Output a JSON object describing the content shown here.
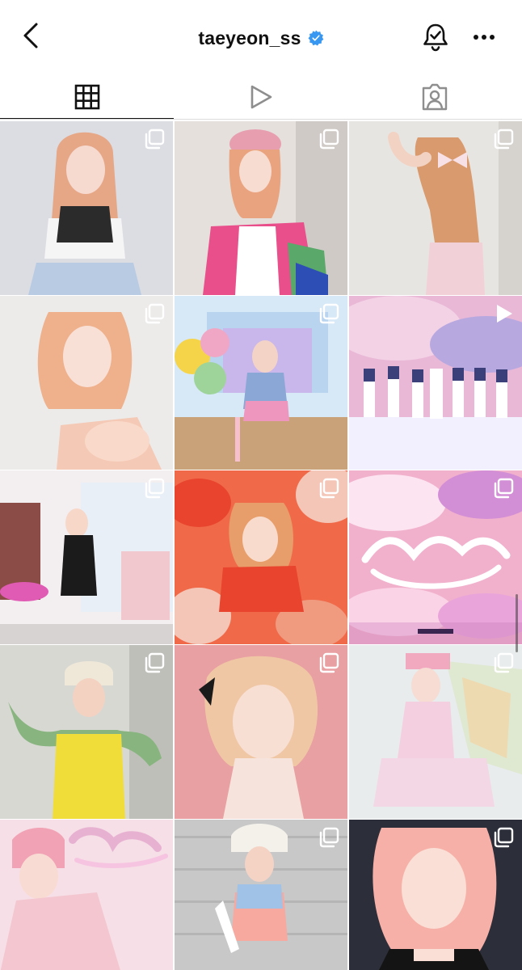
{
  "header": {
    "username": "taeyeon_ss",
    "verified": true,
    "back_icon": "chevron-left-icon",
    "bell_icon": "bell-check-icon",
    "more_icon": "more-horizontal-icon",
    "accent_color": "#3897f0"
  },
  "tabs": [
    {
      "name": "grid",
      "icon": "grid-icon",
      "active": true
    },
    {
      "name": "reels",
      "icon": "play-icon",
      "active": false
    },
    {
      "name": "tagged",
      "icon": "tagged-person-icon",
      "active": false
    }
  ],
  "posts": [
    {
      "badge": "carousel",
      "palette": [
        "#dcdde2",
        "#e6a787",
        "#b9cbe3"
      ]
    },
    {
      "badge": "carousel",
      "palette": [
        "#e5e0dc",
        "#e79fb0",
        "#5aa86a"
      ]
    },
    {
      "badge": "carousel",
      "palette": [
        "#e7e5e2",
        "#d99a6e",
        "#f1d0d8"
      ]
    },
    {
      "badge": "carousel",
      "palette": [
        "#ecebea",
        "#efb08c",
        "#f4c9b5"
      ]
    },
    {
      "badge": "carousel",
      "palette": [
        "#b9d4ef",
        "#f6d44a",
        "#f0a7c5"
      ]
    },
    {
      "badge": "video",
      "palette": [
        "#e9b8d6",
        "#b8a8e0",
        "#f2f0ff"
      ]
    },
    {
      "badge": "carousel",
      "palette": [
        "#f3eef0",
        "#1b1b1b",
        "#e05bb4"
      ]
    },
    {
      "badge": "carousel",
      "palette": [
        "#f06a4a",
        "#e8442e",
        "#f4c6b8"
      ]
    },
    {
      "badge": "carousel",
      "palette": [
        "#f1b1cd",
        "#d38fd6",
        "#fde4f1"
      ]
    },
    {
      "badge": "carousel",
      "palette": [
        "#d8d8d3",
        "#f0dd3a",
        "#88b57f"
      ]
    },
    {
      "badge": "carousel",
      "palette": [
        "#e8a0a2",
        "#f0c7a5",
        "#1a1a1a"
      ]
    },
    {
      "badge": "carousel",
      "palette": [
        "#e8ecec",
        "#f1a9bf",
        "#dfe8d0"
      ]
    },
    {
      "badge": "none",
      "palette": [
        "#f6dfe6",
        "#f1a3b5",
        "#e7b2d2"
      ]
    },
    {
      "badge": "carousel",
      "palette": [
        "#c8c8c8",
        "#f3f1ea",
        "#f7a9a0"
      ]
    },
    {
      "badge": "carousel",
      "palette": [
        "#2c2f3a",
        "#f7b0a7",
        "#141414"
      ]
    }
  ]
}
